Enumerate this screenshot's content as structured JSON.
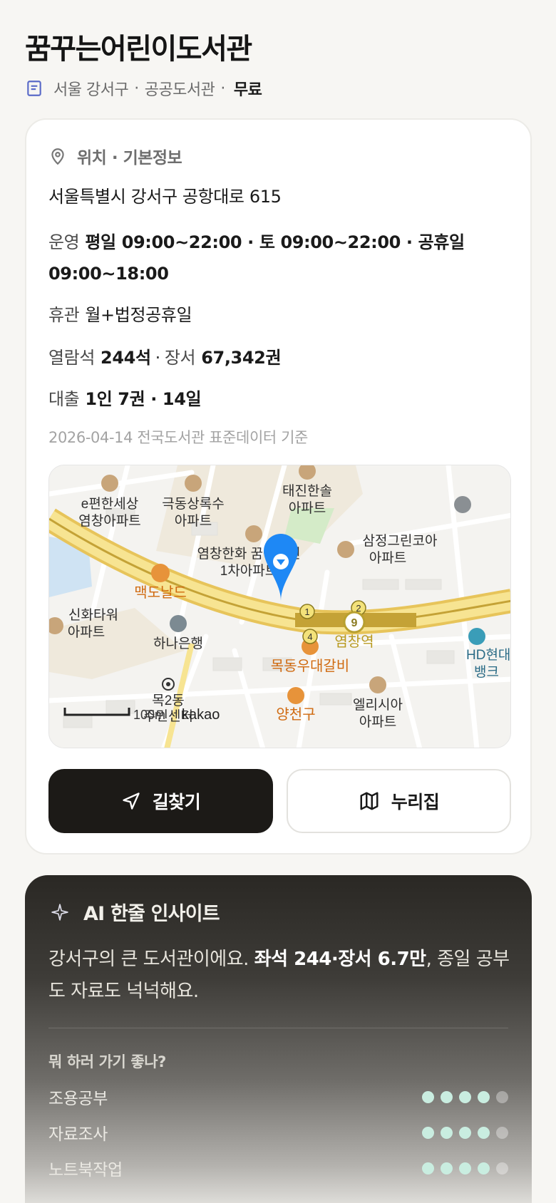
{
  "library": {
    "name": "꿈꾸는어린이도서관",
    "district": "서울 강서구",
    "type": "공공도서관",
    "fee": "무료"
  },
  "info": {
    "section_title": "위치 · 기본정보",
    "address": "서울특별시 강서구 공항대로 615",
    "hours_label": "운영",
    "hours_value": "평일 09:00~22:00 · 토 09:00~22:00 · 공휴일 09:00~18:00",
    "closed_label": "휴관",
    "closed_value": "월+법정공휴일",
    "seats_label": "열람석",
    "seats_value": "244석",
    "books_label": "장서",
    "books_value": "67,342권",
    "loan_label": "대출",
    "loan_value": "1인 7권 · 14일",
    "source": "2026-04-14 전국도서관 표준데이터 기준"
  },
  "map": {
    "labels": {
      "apt1a": "e편한세상",
      "apt1b": "염창아파트",
      "apt2a": "극동상록수",
      "apt2b": "아파트",
      "apt3a": "태진한솔",
      "apt3b": "아파트",
      "apt4a": "염창한화 꿈에그린",
      "apt4b": "1차아파트",
      "apt5a": "삼정그린코아",
      "apt5b": "아파트",
      "apt6a": "신화타워",
      "apt6b": "아파트",
      "mcd": "맥도날드",
      "bank": "하나은행",
      "station": "염창역",
      "galbi": "목동우대갈비",
      "hd1": "HD현대",
      "hd2": "뱅크",
      "mok1": "목2동",
      "mok2": "주민센터",
      "elysia1": "엘리시아",
      "elysia2": "아파트",
      "yangcheon": "양천구",
      "scale": "100m",
      "brand": "kakao",
      "exit1": "1",
      "exit2": "2",
      "exit4": "4",
      "line": "9"
    }
  },
  "buttons": {
    "directions": "길찾기",
    "nurijip": "누리집"
  },
  "ai": {
    "title": "AI 한줄 인사이트",
    "text_pre": "강서구의 큰 도서관이에요. ",
    "text_bold": "좌석 244·장서 6.7만",
    "text_post": ", 종일 공부도 자료도 넉넉해요.",
    "question": "뭐 하러 가기 좋나?",
    "activities": [
      {
        "name": "조용공부",
        "score": 4,
        "max": 5
      },
      {
        "name": "자료조사",
        "score": 4,
        "max": 5
      },
      {
        "name": "노트북작업",
        "score": 4,
        "max": 5
      }
    ]
  },
  "colors": {
    "accent_dark": "#1c1a17",
    "dot_on": "#c9ede0",
    "map_pin": "#1e88f5",
    "road_main": "#f6e08a"
  }
}
